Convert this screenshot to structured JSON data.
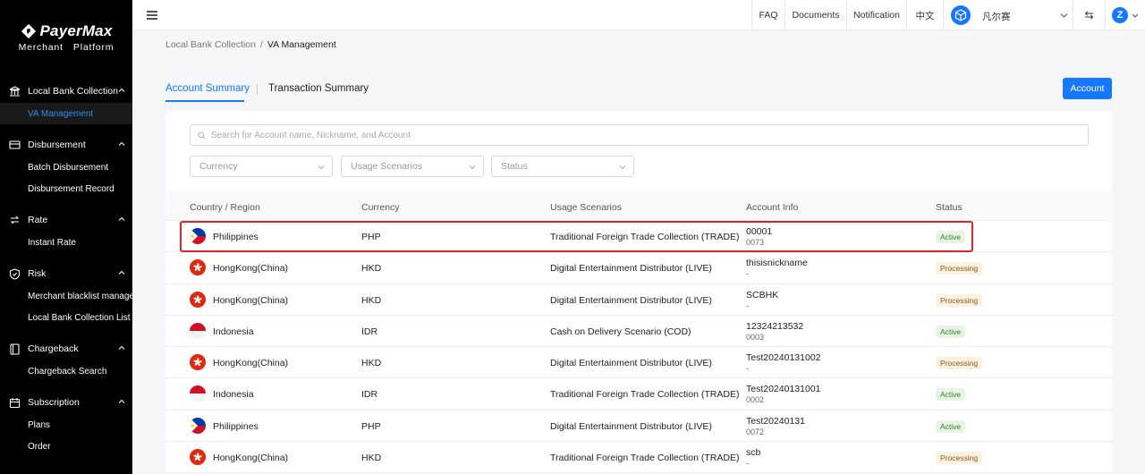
{
  "sidebar": {
    "logo_name": "PayerMax",
    "logo_sub": "Merchant   Platform",
    "groups": [
      {
        "label": "Local Bank Collection",
        "items": [
          "VA Management"
        ]
      },
      {
        "label": "Disbursement",
        "items": [
          "Batch Disbursement",
          "Disbursement Record"
        ]
      },
      {
        "label": "Rate",
        "items": [
          "Instant Rate"
        ]
      },
      {
        "label": "Risk",
        "items": [
          "Merchant blacklist managem",
          "Local Bank Collection List"
        ]
      },
      {
        "label": "Chargeback",
        "items": [
          "Chargeback Search"
        ]
      },
      {
        "label": "Subscription",
        "items": [
          "Plans",
          "Order"
        ]
      }
    ]
  },
  "topbar": {
    "faq": "FAQ",
    "documents": "Documents",
    "notification": "Notification",
    "language": "中文",
    "user_name": "凡尔赛",
    "swap_icon": "⇆",
    "avatar_letter": "Z"
  },
  "breadcrumb": {
    "parent": "Local Bank Collection",
    "separator": "/",
    "current": "VA Management"
  },
  "tabs": {
    "account_summary": "Account Summary",
    "transaction_summary": "Transaction Summary"
  },
  "account_button": "Account",
  "search": {
    "placeholder": "Search for Account name, Nickname, and Account"
  },
  "filters": {
    "currency": "Currency",
    "usage": "Usage Scenarios",
    "status": "Status"
  },
  "table": {
    "headers": [
      "Country / Region",
      "Currency",
      "Usage Scenarios",
      "Account Info",
      "Status"
    ],
    "rows": [
      {
        "flag": "ph",
        "country": "Philippines",
        "currency": "PHP",
        "usage": "Traditional Foreign Trade Collection (TRADE)",
        "acc1": "00001",
        "acc2": "0073",
        "status": "Active",
        "status_type": "active"
      },
      {
        "flag": "hk",
        "country": "HongKong(China)",
        "currency": "HKD",
        "usage": "Digital Entertainment Distributor (LIVE)",
        "acc1": "thisisnickname",
        "acc2": "-",
        "status": "Processing",
        "status_type": "processing"
      },
      {
        "flag": "hk",
        "country": "HongKong(China)",
        "currency": "HKD",
        "usage": "Digital Entertainment Distributor (LIVE)",
        "acc1": "SCBHK",
        "acc2": "-",
        "status": "Processing",
        "status_type": "processing"
      },
      {
        "flag": "id",
        "country": "Indonesia",
        "currency": "IDR",
        "usage": "Cash on Delivery Scenario (COD)",
        "acc1": "12324213532",
        "acc2": "0003",
        "status": "Active",
        "status_type": "active"
      },
      {
        "flag": "hk",
        "country": "HongKong(China)",
        "currency": "HKD",
        "usage": "Digital Entertainment Distributor (LIVE)",
        "acc1": "Test20240131002",
        "acc2": "-",
        "status": "Processing",
        "status_type": "processing"
      },
      {
        "flag": "id",
        "country": "Indonesia",
        "currency": "IDR",
        "usage": "Traditional Foreign Trade Collection (TRADE)",
        "acc1": "Test20240131001",
        "acc2": "0002",
        "status": "Active",
        "status_type": "active"
      },
      {
        "flag": "ph",
        "country": "Philippines",
        "currency": "PHP",
        "usage": "Digital Entertainment Distributor (LIVE)",
        "acc1": "Test20240131",
        "acc2": "0072",
        "status": "Active",
        "status_type": "active"
      },
      {
        "flag": "hk",
        "country": "HongKong(China)",
        "currency": "HKD",
        "usage": "Traditional Foreign Trade Collection (TRADE)",
        "acc1": "scb",
        "acc2": "-",
        "status": "Processing",
        "status_type": "processing"
      }
    ]
  },
  "colors": {
    "primary": "#1677ff",
    "highlight": "#d9262e",
    "sidebar": "#000000"
  }
}
